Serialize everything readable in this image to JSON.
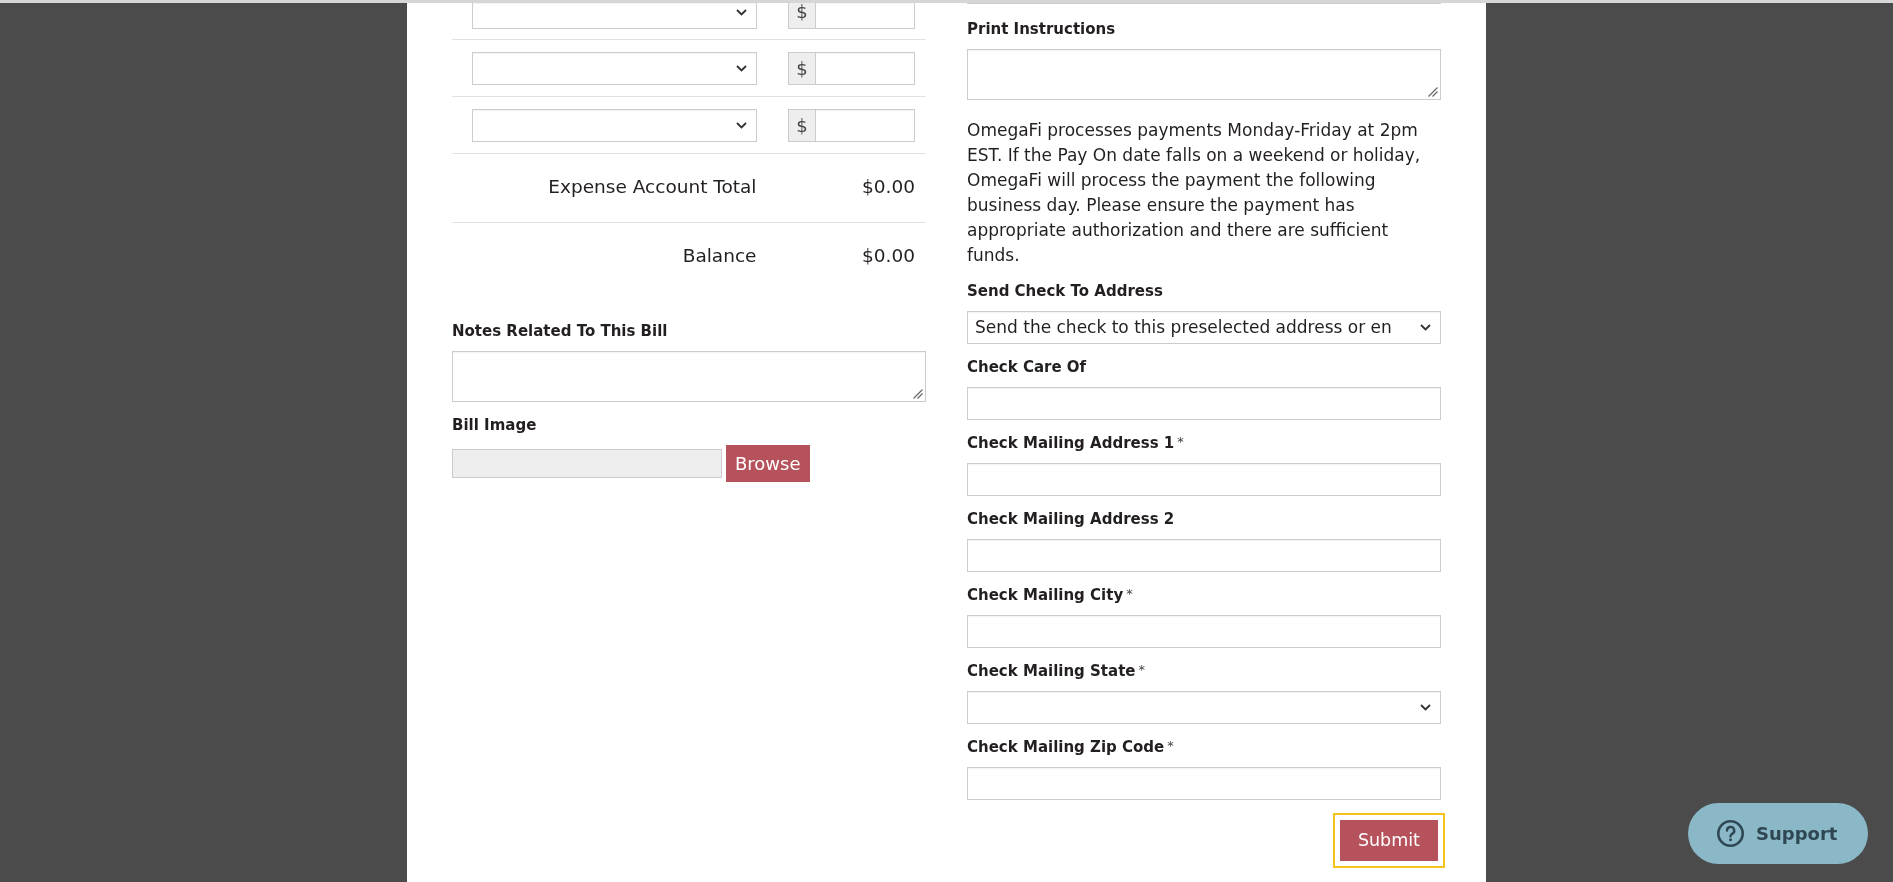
{
  "expense_rows": [
    {
      "currency_symbol": "$"
    },
    {
      "currency_symbol": "$"
    },
    {
      "currency_symbol": "$"
    }
  ],
  "totals": [
    {
      "label": "Expense Account Total",
      "value": "$0.00"
    },
    {
      "label": "Balance",
      "value": "$0.00"
    }
  ],
  "left_fields": [
    {
      "kind": "textarea",
      "label": "Notes Related To This Bill"
    },
    {
      "kind": "file",
      "label": "Bill Image",
      "button": "Browse"
    }
  ],
  "right_fields": [
    {
      "kind": "textarea",
      "label": "Print Instructions"
    },
    {
      "kind": "notice",
      "text": "OmegaFi processes payments Monday-Friday at 2pm EST. If the Pay On date falls on a weekend or holiday, OmegaFi will process the payment the following business day. Please ensure the payment has appropriate authorization and there are sufficient funds."
    },
    {
      "kind": "select",
      "label": "Send Check To Address",
      "value": "Send the check to this preselected address or en"
    },
    {
      "kind": "text",
      "label": "Check Care Of"
    },
    {
      "kind": "text",
      "label": "Check Mailing Address 1",
      "required_mark": "*"
    },
    {
      "kind": "text",
      "label": "Check Mailing Address 2"
    },
    {
      "kind": "text",
      "label": "Check Mailing City",
      "required_mark": "*"
    },
    {
      "kind": "select",
      "label": "Check Mailing State",
      "required_mark": "*"
    },
    {
      "kind": "text",
      "label": "Check Mailing Zip Code",
      "required_mark": "*"
    }
  ],
  "submit": {
    "label": "Submit",
    "focused": true
  },
  "support": {
    "label": "Support"
  }
}
